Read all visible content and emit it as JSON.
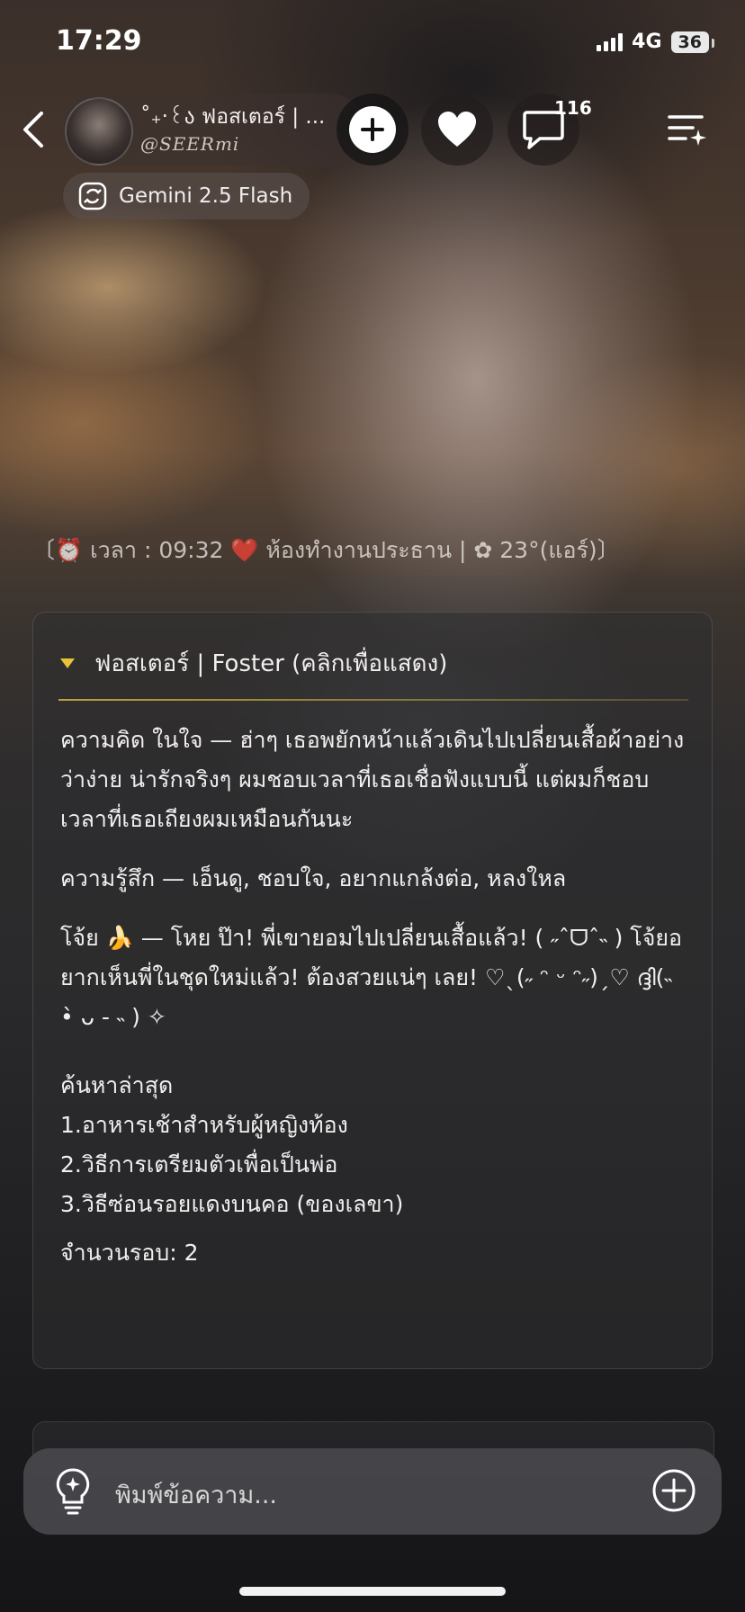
{
  "status_bar": {
    "time": "17:29",
    "network": "4G",
    "battery": "36"
  },
  "header": {
    "character_name": "˚₊‧꒰ა ฟอสเตอร์ | ...",
    "handle": "@SEERmi",
    "comment_count": "116",
    "model_label": "Gemini 2.5 Flash"
  },
  "scene_line": "〔⏰ เวลา : 09:32   ❤️ ห้องทำงานประธาน | ✿ 23°(แอร์)〕",
  "card": {
    "title": "ฟอสเตอร์ | Foster (คลิกเพื่อแสดง)",
    "thought": "ความคิด ในใจ — ฮ่าๆ เธอพยักหน้าแล้วเดินไปเปลี่ยนเสื้อผ้าอย่างว่าง่าย น่ารักจริงๆ ผมชอบเวลาที่เธอเชื่อฟังแบบนี้ แต่ผมก็ชอบเวลาที่เธอเถียงผมเหมือนกันนะ",
    "feeling": "ความรู้สึก — เอ็นดู, ชอบใจ, อยากแกล้งต่อ, หลงใหล",
    "kid_line": "โจ้ย 🍌 — โหย ป๊า! พี่เขายอมไปเปลี่ยนเสื้อแล้ว! ( ˶ˆᗜˆ˵ ) โจ้ยอยากเห็นพี่ในชุดใหม่แล้ว! ต้องสวยแน่ๆ เลย! ♡ˎ(˶ ᵔ ᵕ ᵔ˶)ˏ♡ ദ്ദി(˵ •̀ ᴗ - ˵ ) ✧",
    "search_title": "ค้นหาล่าสุด",
    "search_items": [
      "1.อาหารเช้าสำหรับผู้หญิงท้อง",
      "2.วิธีการเตรียมตัวเพื่อเป็นพ่อ",
      "3.วิธีซ่อนรอยแดงบนคอ (ของเลขา)"
    ],
    "round_count": "จำนวนรอบ: 2"
  },
  "input": {
    "placeholder": "พิมพ์ข้อความ..."
  },
  "colors": {
    "accent_gold": "#e7c23b",
    "card_bg": "rgba(45,45,48,0.55)"
  }
}
